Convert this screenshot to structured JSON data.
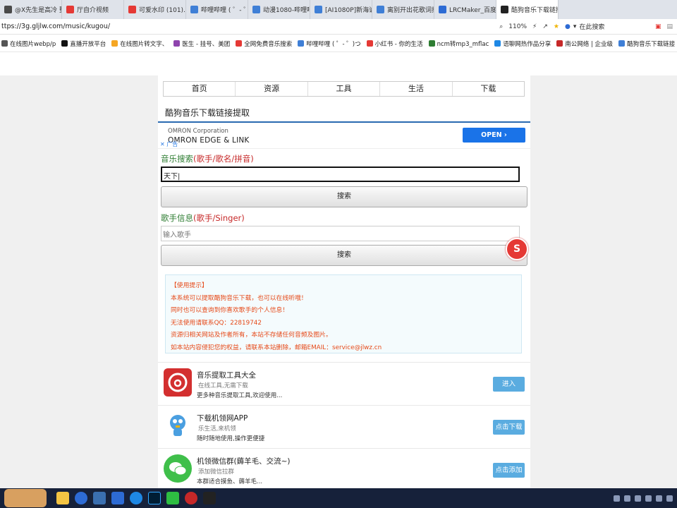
{
  "browser": {
    "tabs": [
      {
        "label": "@X先生是高冷 整理",
        "color": "#4a4a4a",
        "active": false
      },
      {
        "label": "厅自介视频",
        "color": "#e53935",
        "active": false
      },
      {
        "label": "可爱水印 (101).png",
        "color": "#e53935",
        "active": false
      },
      {
        "label": "哔哩哔哩 ( ゜- ゜)つロ",
        "color": "#3f7fd6",
        "active": false
      },
      {
        "label": "动漫1080-哔哩哔哩",
        "color": "#3f7fd6",
        "active": false
      },
      {
        "label": "[AI1080P]新海诚超",
        "color": "#3f7fd6",
        "active": false
      },
      {
        "label": "离别开出花歌词抖指",
        "color": "#3f7fd6",
        "active": false
      },
      {
        "label": "LRCMaker_百度搜索",
        "color": "#2d6bd4",
        "active": false
      },
      {
        "label": "酷狗音乐下载链接",
        "color": "#222",
        "active": true
      }
    ],
    "url": "ttps://3g.gljlw.com/music/kugou/",
    "zoom": "110%",
    "search_placeholder": "在此搜索",
    "bookmarks": [
      "在线图片webp/p",
      "直播开放平台",
      "在线图片转文字、",
      "医生 - 挂号、美团",
      "全网免费音乐搜索",
      "哔哩哔哩 ( ゜- ゜)つ",
      "小红书 - 你的生活",
      "ncm转mp3_mflac",
      "语聊网热作品分享",
      "南公网络 | 企业级",
      "酷狗音乐下载链接"
    ]
  },
  "nav": [
    "首页",
    "资源",
    "工具",
    "生活",
    "下载"
  ],
  "page_title": "酷狗音乐下载链接提取",
  "ad": {
    "corp": "OMRON Corporation",
    "name": "OMRON EDGE & LINK",
    "open_label": "OPEN ›",
    "close_label": "✕ 广告"
  },
  "search_music": {
    "label_prefix": "音乐搜索",
    "label_suffix": "(歌手/歌名/拼音)",
    "value": "天下|",
    "button": "搜索"
  },
  "singer_info": {
    "label_prefix": "歌手信息",
    "label_suffix": "(歌手/Singer)",
    "placeholder": "输入歌手",
    "button": "搜索"
  },
  "float_badge": "S",
  "tips": [
    "【使用提示】",
    "本系统可以提取酷狗音乐下载，也可以在线听哦！",
    "同时也可以查询到你喜欢歌手的个人信息！",
    "无法使用请联系QQ：22819742",
    "资源归相关网站及作者所有，本站不存储任何音频及图片。",
    "如本站内容侵犯您的权益，请联系本站删除，邮箱EMAIL：service@jlwz.cn"
  ],
  "cards": [
    {
      "title": "音乐提取工具大全",
      "sub": "在线工具,无需下载",
      "desc": "更多种音乐提取工具,欢迎使用...",
      "cta": "进入",
      "icon": "netease-music-icon"
    },
    {
      "title": "下载机领网APP",
      "sub": "乐生活,来机领",
      "desc": "随时随地使用,操作更便捷",
      "cta": "点击下载",
      "icon": "mascot-icon"
    },
    {
      "title": "机领微信群(薅羊毛、交流~)",
      "sub": "添加微信拉群",
      "desc": "本群适合摸鱼、薅羊毛...",
      "cta": "点击添加",
      "icon": "wechat-icon"
    }
  ],
  "colors": {
    "accent_blue": "#2a6ab1",
    "tip_red": "#e64a19",
    "label_green": "#2e7d32",
    "label_red": "#c62828",
    "cta_blue": "#5aace0"
  }
}
